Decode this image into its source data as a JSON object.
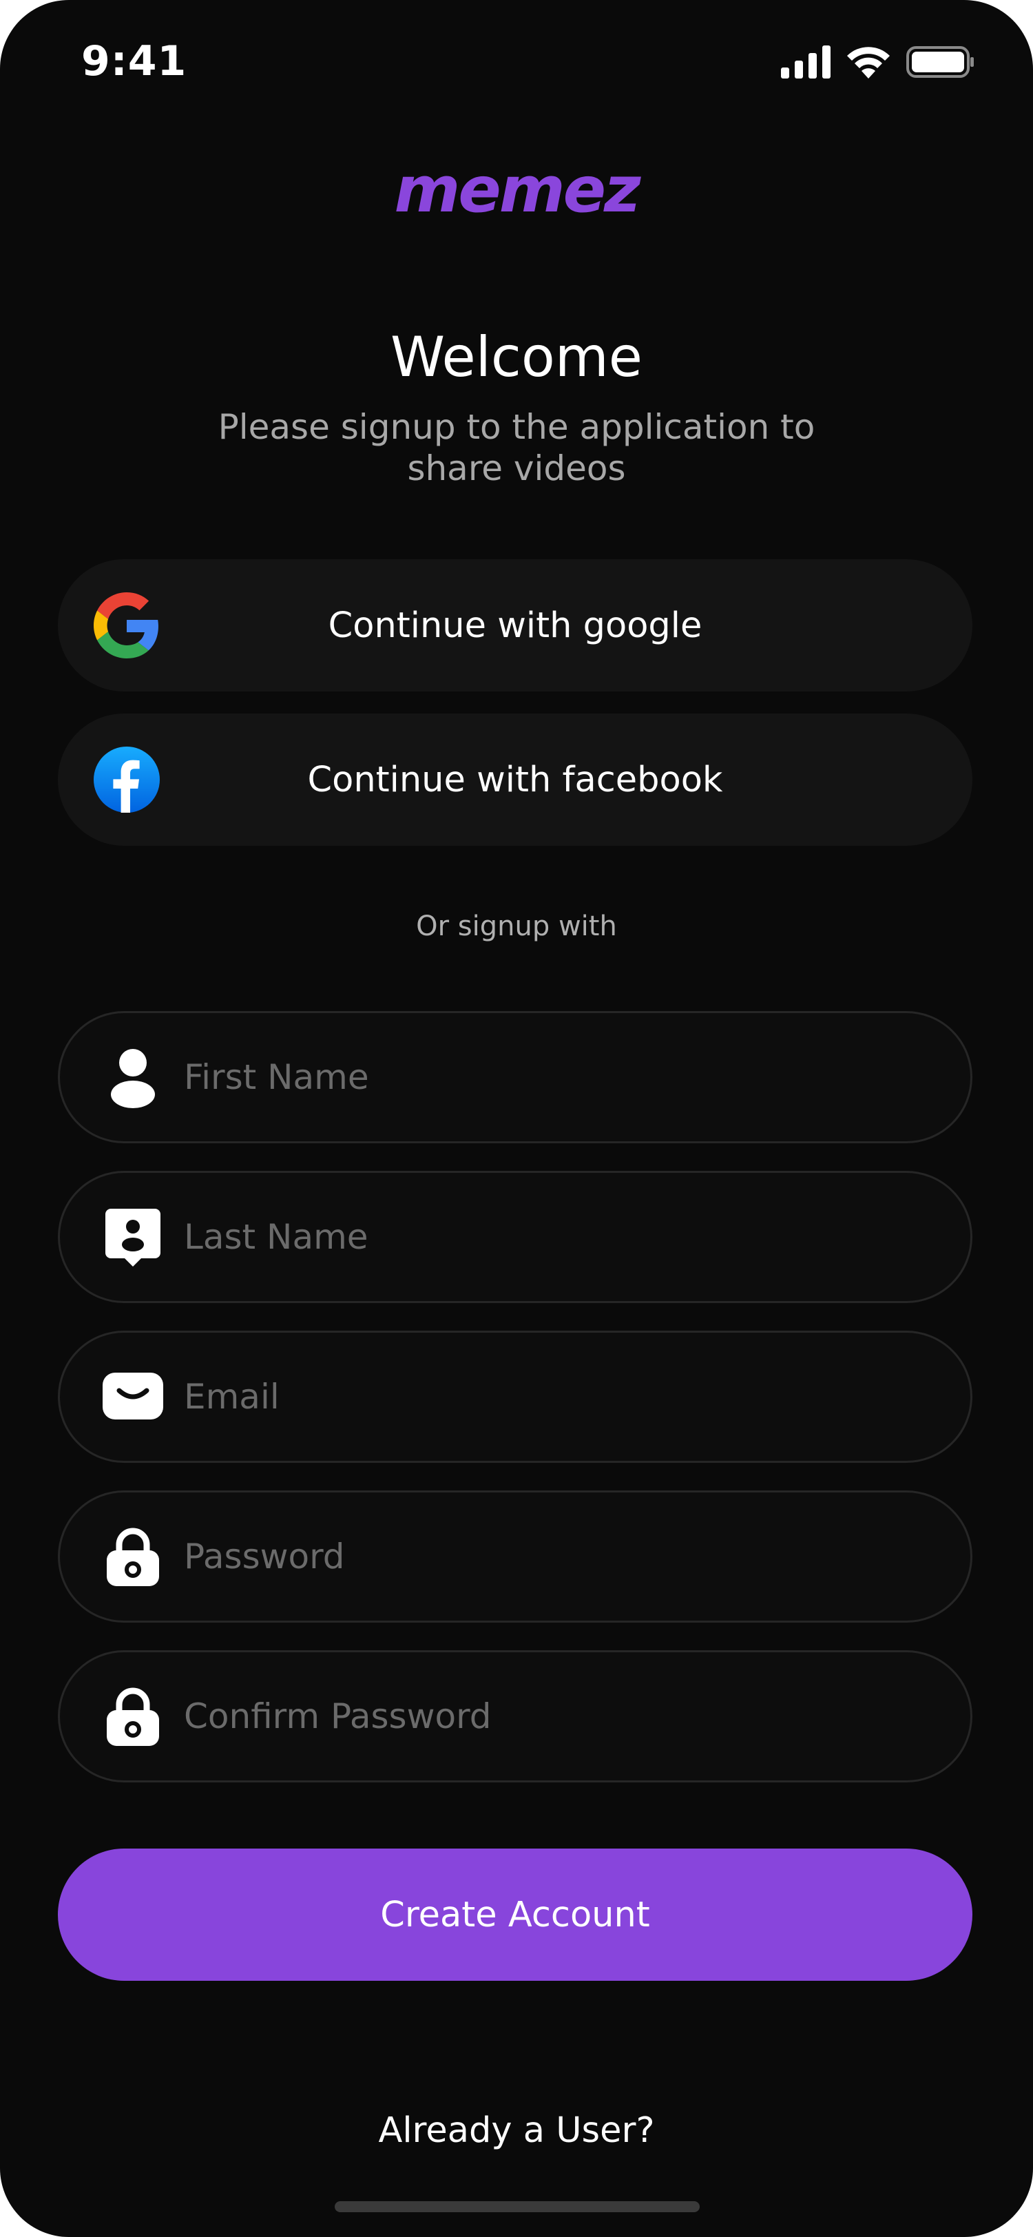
{
  "status_bar": {
    "time": "9:41",
    "signal_icon": "cellular-signal-icon",
    "wifi_icon": "wifi-icon",
    "battery_icon": "battery-icon"
  },
  "brand": {
    "logo_text": "memez",
    "accent_color": "#8845dc"
  },
  "header": {
    "title": "Welcome",
    "subtitle": "Please signup to the application to share videos"
  },
  "social": {
    "google": {
      "label": "Continue with google",
      "icon": "google-icon"
    },
    "facebook": {
      "label": "Continue with facebook",
      "icon": "facebook-icon"
    }
  },
  "divider": "Or signup with",
  "form": {
    "first_name": {
      "placeholder": "First Name",
      "value": "",
      "icon": "user-icon"
    },
    "last_name": {
      "placeholder": "Last Name",
      "value": "",
      "icon": "contact-card-icon"
    },
    "email": {
      "placeholder": "Email",
      "value": "",
      "icon": "mail-icon"
    },
    "password": {
      "placeholder": "Password",
      "value": "",
      "icon": "lock-icon"
    },
    "confirm_password": {
      "placeholder": "Confirm Password",
      "value": "",
      "icon": "lock-icon"
    }
  },
  "actions": {
    "create_account": "Create Account",
    "already_user": "Already a User?"
  }
}
